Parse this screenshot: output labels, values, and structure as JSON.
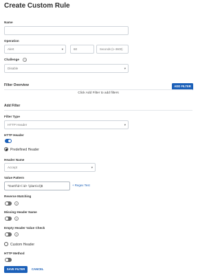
{
  "page": {
    "title": "Create Custom Rule"
  },
  "name": {
    "label": "Name",
    "value": ""
  },
  "operation": {
    "label": "Operation",
    "action_value": "Alert",
    "count_value": "60",
    "unit_value": "Seconds (1–3600)"
  },
  "challenge": {
    "label": "Challenge",
    "value": "Disable"
  },
  "filter_overview": {
    "title": "Filter Overview",
    "empty_message": "Click Add Filter to add filters",
    "add_button": "ADD FILTER"
  },
  "add_filter": {
    "title": "Add Filter",
    "filter_type_label": "Filter Type",
    "filter_type_value": "HTTP Header",
    "http_header_label": "HTTP Header",
    "http_header_on": true,
    "predefined_label": "Predefined Header",
    "header_name_label": "Header Name",
    "header_name_value": "Accept",
    "value_pattern_label": "Value Pattern",
    "value_pattern_value": "^Dart\\/\\d+\\.\\d+ \\(dart:io\\)$",
    "regex_link": "+ Regex Test",
    "reverse_matching_label": "Reverse Matching",
    "missing_header_label": "Missing Header Name",
    "empty_header_label": "Empty Header Value Check",
    "custom_header_label": "Custom Header",
    "http_method_label": "HTTP Method"
  },
  "actions": {
    "save": "SAVE FILTER",
    "cancel": "CANCEL"
  },
  "icons": {
    "help": "help-circle-icon",
    "chevron": "chevron-down-icon"
  },
  "colors": {
    "primary": "#1a5fb8",
    "toggle_off": "#6b6b6b"
  }
}
